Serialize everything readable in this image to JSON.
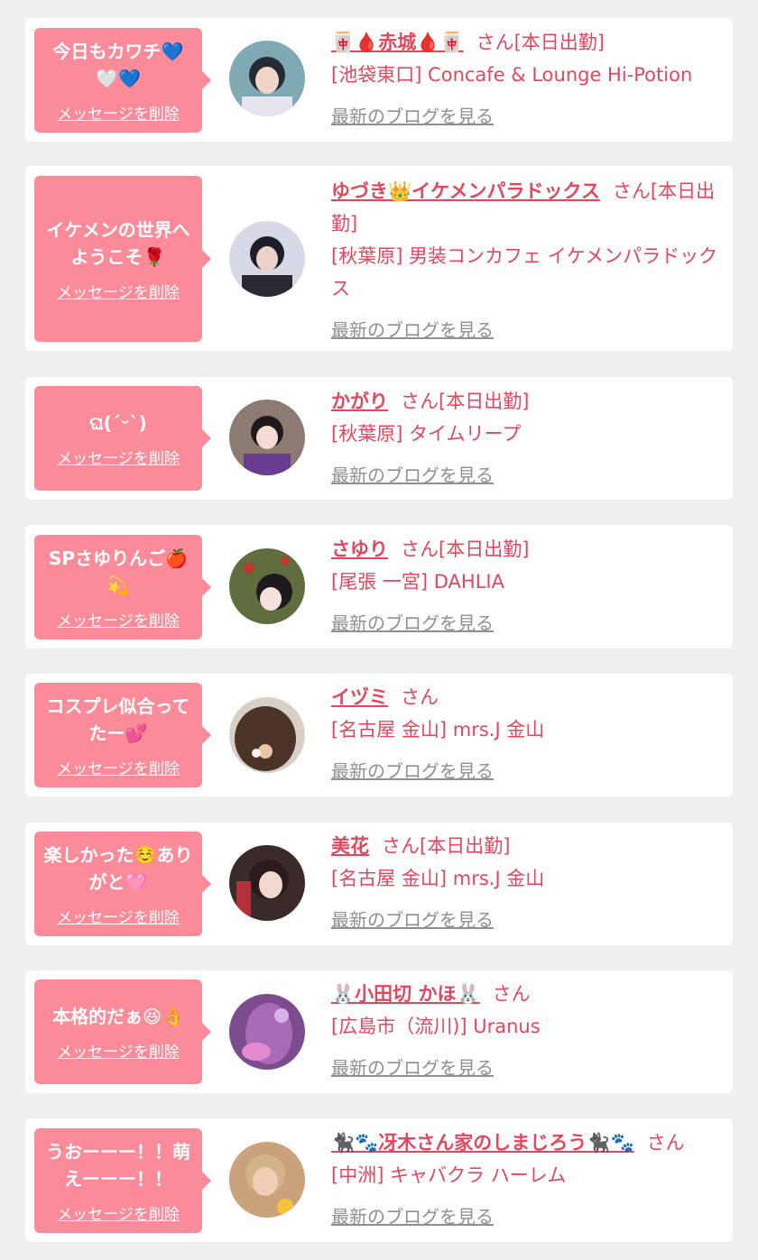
{
  "delete_label": "メッセージを削除",
  "blog_label": "最新のブログを見る",
  "san_suffix": "さん",
  "colors": {
    "background": "#efefef",
    "card": "#ffffff",
    "bubble": "#fb8b98",
    "name": "#e3475e",
    "blog_link": "#8f8f8f"
  },
  "cards": [
    {
      "message": "今日もカワチ💙🤍💙",
      "name": "🀄🩸赤城🩸🀄",
      "status": "[本日出勤]",
      "shop": "[池袋東口] Concafe & Lounge Hi-Potion",
      "avatar": "avatar-photo"
    },
    {
      "message": "イケメンの世界へようこそ🌹",
      "name": "ゆづき👑イケメンパラドックス",
      "status": "[本日出勤]",
      "shop": "[秋葉原] 男装コンカフェ イケメンパラドックス",
      "avatar": "avatar-photo"
    },
    {
      "message": "ଘ(ˊᵕˋ)",
      "name": "かがり",
      "status": "[本日出勤]",
      "shop": "[秋葉原] タイムリープ",
      "avatar": "avatar-photo"
    },
    {
      "message": "SPさゆりんご🍎💫",
      "name": "さゆり",
      "status": "[本日出勤]",
      "shop": "[尾張 一宮] DAHLIA",
      "avatar": "avatar-photo"
    },
    {
      "message": "コスプレ似合ってたー💕",
      "name": "イヅミ",
      "status": "",
      "shop": "[名古屋 金山] mrs.J 金山",
      "avatar": "avatar-photo"
    },
    {
      "message": "楽しかった☺️ありがと🩷",
      "name": "美花",
      "status": "[本日出勤]",
      "shop": "[名古屋 金山] mrs.J 金山",
      "avatar": "avatar-photo"
    },
    {
      "message": "本格的だぁ😆👌",
      "name": "🐰小田切 かほ🐰",
      "status": "",
      "shop": "[広島市（流川)] Uranus",
      "avatar": "avatar-photo"
    },
    {
      "message": "うおーーー！！萌えーーー！！",
      "name": "🐈‍⬛🐾冴木さん家のしまじろう🐈‍⬛🐾",
      "status": "",
      "shop": "[中洲] キャバクラ ハーレム",
      "avatar": "avatar-photo"
    }
  ]
}
